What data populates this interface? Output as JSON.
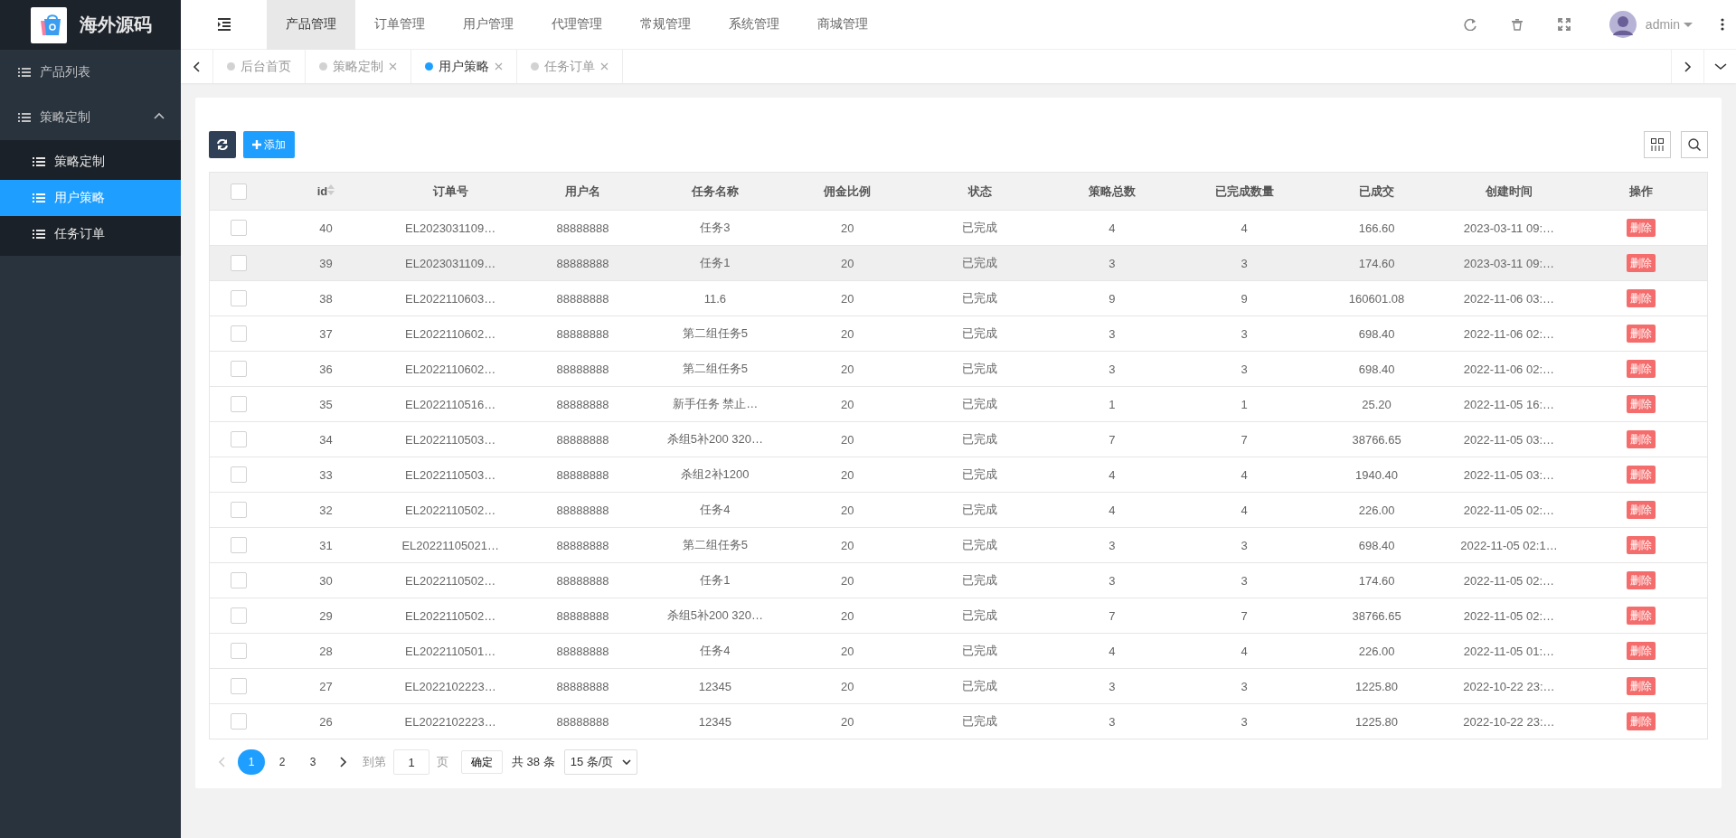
{
  "sidebar": {
    "logo_text": "海外源码",
    "items": [
      {
        "label": "产品列表",
        "selected": false
      },
      {
        "label": "策略定制",
        "selected": false,
        "expanded": true,
        "children": [
          {
            "label": "策略定制",
            "selected": false
          },
          {
            "label": "用户策略",
            "selected": true
          },
          {
            "label": "任务订单",
            "selected": false
          }
        ]
      }
    ]
  },
  "top_nav": {
    "menus": [
      {
        "label": "产品管理",
        "selected": true
      },
      {
        "label": "订单管理",
        "selected": false
      },
      {
        "label": "用户管理",
        "selected": false
      },
      {
        "label": "代理管理",
        "selected": false
      },
      {
        "label": "常规管理",
        "selected": false
      },
      {
        "label": "系统管理",
        "selected": false
      },
      {
        "label": "商城管理",
        "selected": false
      }
    ],
    "user": {
      "name": "admin"
    }
  },
  "tabs": [
    {
      "label": "后台首页",
      "selected": false,
      "closable": false
    },
    {
      "label": "策略定制",
      "selected": false,
      "closable": true
    },
    {
      "label": "用户策略",
      "selected": true,
      "closable": true
    },
    {
      "label": "任务订单",
      "selected": false,
      "closable": true
    }
  ],
  "toolbar": {
    "add_button": "添加"
  },
  "table": {
    "header_checked": false,
    "columns": [
      "id",
      "订单号",
      "用户名",
      "任务名称",
      "佣金比例",
      "状态",
      "策略总数",
      "已完成数量",
      "已成交",
      "创建时间",
      "操作"
    ],
    "rows": [
      {
        "checked": false,
        "hovered": false,
        "cells": [
          "40",
          "EL2023031109…",
          "88888888",
          "任务3",
          "20",
          "已完成",
          "4",
          "4",
          "166.60",
          "2023-03-11 09:…"
        ],
        "action": "删除"
      },
      {
        "checked": false,
        "hovered": true,
        "cells": [
          "39",
          "EL2023031109…",
          "88888888",
          "任务1",
          "20",
          "已完成",
          "3",
          "3",
          "174.60",
          "2023-03-11 09:…"
        ],
        "action": "删除"
      },
      {
        "checked": false,
        "hovered": false,
        "cells": [
          "38",
          "EL2022110603…",
          "88888888",
          "11.6",
          "20",
          "已完成",
          "9",
          "9",
          "160601.08",
          "2022-11-06 03:…"
        ],
        "action": "删除"
      },
      {
        "checked": false,
        "hovered": false,
        "cells": [
          "37",
          "EL2022110602…",
          "88888888",
          "第二组任务5",
          "20",
          "已完成",
          "3",
          "3",
          "698.40",
          "2022-11-06 02:…"
        ],
        "action": "删除"
      },
      {
        "checked": false,
        "hovered": false,
        "cells": [
          "36",
          "EL2022110602…",
          "88888888",
          "第二组任务5",
          "20",
          "已完成",
          "3",
          "3",
          "698.40",
          "2022-11-06 02:…"
        ],
        "action": "删除"
      },
      {
        "checked": false,
        "hovered": false,
        "cells": [
          "35",
          "EL2022110516…",
          "88888888",
          "新手任务 禁止…",
          "20",
          "已完成",
          "1",
          "1",
          "25.20",
          "2022-11-05 16:…"
        ],
        "action": "删除"
      },
      {
        "checked": false,
        "hovered": false,
        "cells": [
          "34",
          "EL2022110503…",
          "88888888",
          "杀组5补200 320…",
          "20",
          "已完成",
          "7",
          "7",
          "38766.65",
          "2022-11-05 03:…"
        ],
        "action": "删除"
      },
      {
        "checked": false,
        "hovered": false,
        "cells": [
          "33",
          "EL2022110503…",
          "88888888",
          "杀组2补1200",
          "20",
          "已完成",
          "4",
          "4",
          "1940.40",
          "2022-11-05 03:…"
        ],
        "action": "删除"
      },
      {
        "checked": false,
        "hovered": false,
        "cells": [
          "32",
          "EL2022110502…",
          "88888888",
          "任务4",
          "20",
          "已完成",
          "4",
          "4",
          "226.00",
          "2022-11-05 02:…"
        ],
        "action": "删除"
      },
      {
        "checked": false,
        "hovered": false,
        "cells": [
          "31",
          "EL20221105021…",
          "88888888",
          "第二组任务5",
          "20",
          "已完成",
          "3",
          "3",
          "698.40",
          "2022-11-05 02:1…"
        ],
        "action": "删除"
      },
      {
        "checked": false,
        "hovered": false,
        "cells": [
          "30",
          "EL2022110502…",
          "88888888",
          "任务1",
          "20",
          "已完成",
          "3",
          "3",
          "174.60",
          "2022-11-05 02:…"
        ],
        "action": "删除"
      },
      {
        "checked": false,
        "hovered": false,
        "cells": [
          "29",
          "EL2022110502…",
          "88888888",
          "杀组5补200 320…",
          "20",
          "已完成",
          "7",
          "7",
          "38766.65",
          "2022-11-05 02:…"
        ],
        "action": "删除"
      },
      {
        "checked": false,
        "hovered": false,
        "cells": [
          "28",
          "EL2022110501…",
          "88888888",
          "任务4",
          "20",
          "已完成",
          "4",
          "4",
          "226.00",
          "2022-11-05 01:…"
        ],
        "action": "删除"
      },
      {
        "checked": false,
        "hovered": false,
        "cells": [
          "27",
          "EL2022102223…",
          "88888888",
          "12345",
          "20",
          "已完成",
          "3",
          "3",
          "1225.80",
          "2022-10-22 23:…"
        ],
        "action": "删除"
      },
      {
        "checked": false,
        "hovered": false,
        "cells": [
          "26",
          "EL2022102223…",
          "88888888",
          "12345",
          "20",
          "已完成",
          "3",
          "3",
          "1225.80",
          "2022-10-22 23:…"
        ],
        "action": "删除"
      }
    ]
  },
  "pagination": {
    "prev_disabled": true,
    "pages": [
      {
        "label": "1",
        "selected": true
      },
      {
        "label": "2",
        "selected": false
      },
      {
        "label": "3",
        "selected": false
      }
    ],
    "goto_label": "到第",
    "goto_value": "1",
    "page_unit": "页",
    "confirm": "确定",
    "total": "共 38 条",
    "page_size": "15 条/页"
  }
}
